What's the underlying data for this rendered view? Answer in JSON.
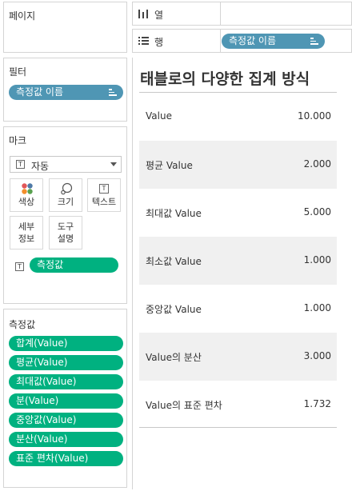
{
  "pages": {
    "title": "페이지"
  },
  "filters": {
    "title": "필터",
    "pill": "측정값 이름"
  },
  "marks": {
    "title": "마크",
    "mark_type": "자동",
    "buttons": {
      "color": "색상",
      "size": "크기",
      "text": "텍스트",
      "detail_line1": "세부",
      "detail_line2": "정보",
      "tooltip_line1": "도구",
      "tooltip_line2": "설명"
    },
    "text_pill": "측정값"
  },
  "measures": {
    "title": "측정값",
    "items": [
      "합계(Value)",
      "평균(Value)",
      "최대값(Value)",
      "분(Value)",
      "중앙값(Value)",
      "분산(Value)",
      "표준 편차(Value)"
    ]
  },
  "shelves": {
    "columns_label": "열",
    "rows_label": "행",
    "rows_pill": "측정값 이름"
  },
  "viz": {
    "title": "태블로의 다양한 집계 방식",
    "rows": [
      {
        "name": "Value",
        "value": "10.000"
      },
      {
        "name": "평균 Value",
        "value": "2.000"
      },
      {
        "name": "최대값 Value",
        "value": "5.000"
      },
      {
        "name": "최소값 Value",
        "value": "1.000"
      },
      {
        "name": "중앙값 Value",
        "value": "1.000"
      },
      {
        "name": "Value의 분산",
        "value": "3.000"
      },
      {
        "name": "Value의 표준 편차",
        "value": "1.732"
      }
    ]
  },
  "colors": {
    "dimension_pill": "#4f96b4",
    "measure_pill": "#00b180",
    "row_band": "#f0f0f0"
  }
}
